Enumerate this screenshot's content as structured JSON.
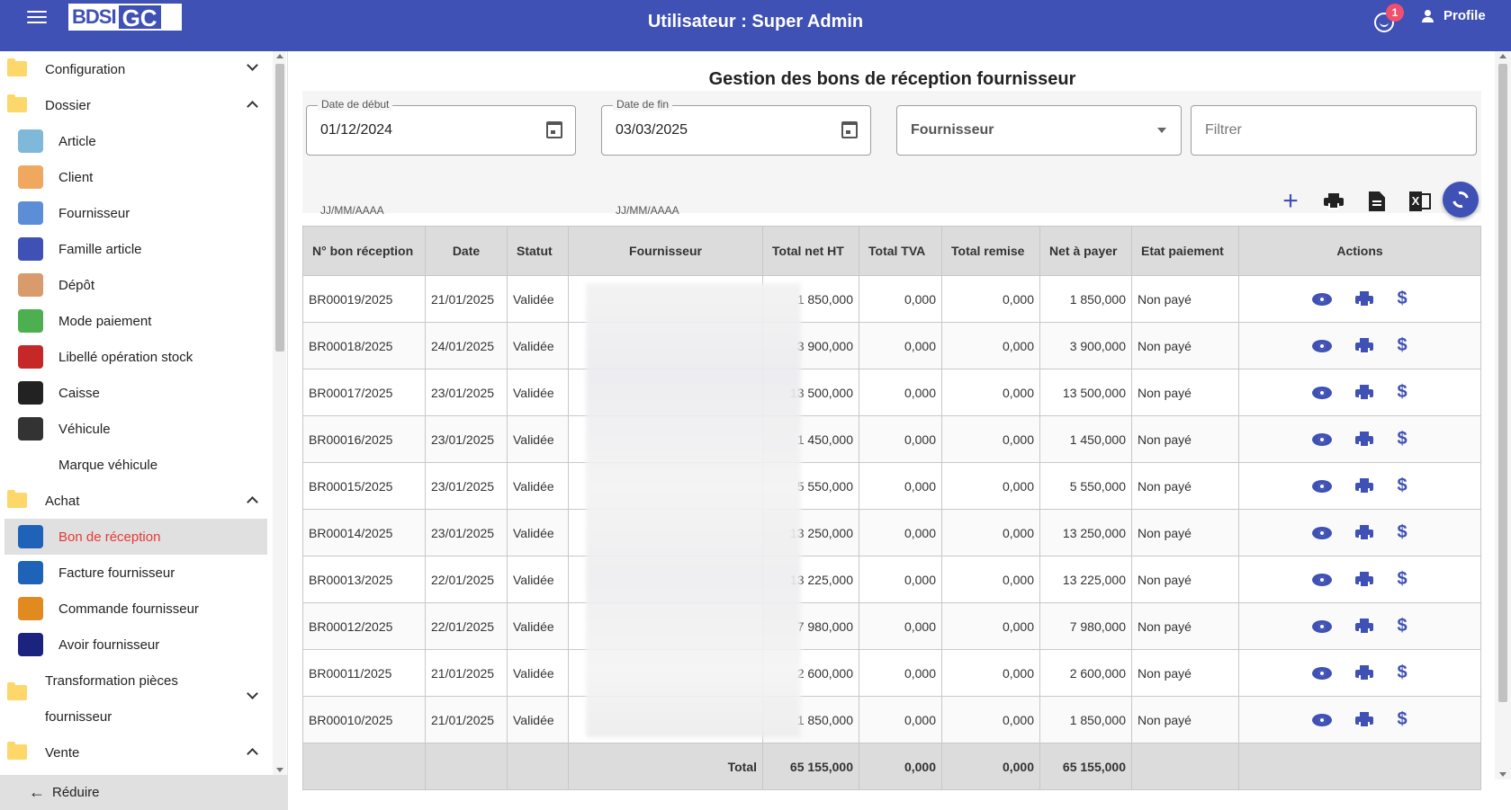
{
  "header": {
    "logo_left": "BDSI",
    "logo_right": "GC",
    "title": "Utilisateur : Super Admin",
    "notification_count": "1",
    "profile_label": "Profile",
    "brand_color": "#3f51b5"
  },
  "sidebar": {
    "items": [
      {
        "label": "Configuration",
        "type": "section",
        "expanded": false
      },
      {
        "label": "Dossier",
        "type": "section",
        "expanded": true
      },
      {
        "label": "Article",
        "type": "sub",
        "icon": "tag-icon"
      },
      {
        "label": "Client",
        "type": "sub",
        "icon": "client-icon"
      },
      {
        "label": "Fournisseur",
        "type": "sub",
        "icon": "building-icon"
      },
      {
        "label": "Famille article",
        "type": "sub",
        "icon": "group-icon"
      },
      {
        "label": "Dépôt",
        "type": "sub",
        "icon": "warehouse-icon"
      },
      {
        "label": "Mode paiement",
        "type": "sub",
        "icon": "payment-icon"
      },
      {
        "label": "Libellé opération stock",
        "type": "sub",
        "icon": "transfer-arrows-icon"
      },
      {
        "label": "Caisse",
        "type": "sub",
        "icon": "safe-icon"
      },
      {
        "label": "Véhicule",
        "type": "sub",
        "icon": "truck-icon"
      },
      {
        "label": "Marque véhicule",
        "type": "sub",
        "icon": ""
      },
      {
        "label": "Achat",
        "type": "section",
        "expanded": true
      },
      {
        "label": "Bon de réception",
        "type": "sub",
        "icon": "receipt-icon",
        "active": true
      },
      {
        "label": "Facture fournisseur",
        "type": "sub",
        "icon": "invoice-icon"
      },
      {
        "label": "Commande fournisseur",
        "type": "sub",
        "icon": "order-icon"
      },
      {
        "label": "Avoir fournisseur",
        "type": "sub",
        "icon": "reply-arrow-icon"
      },
      {
        "label": "Transformation pièces",
        "type": "section2"
      },
      {
        "label": "fournisseur",
        "type": "section2b"
      },
      {
        "label": "Vente",
        "type": "section",
        "expanded": true
      }
    ],
    "reduce_label": "Réduire"
  },
  "page": {
    "title": "Gestion des bons de réception fournisseur",
    "filters": {
      "start_label": "Date de début",
      "start_value": "01/12/2024",
      "start_hint": "JJ/MM/AAAA",
      "end_label": "Date de fin",
      "end_value": "03/03/2025",
      "end_hint": "JJ/MM/AAAA",
      "supplier_placeholder": "Fournisseur",
      "filter_placeholder": "Filtrer"
    }
  },
  "table": {
    "columns": [
      "N° bon réception",
      "Date",
      "Statut",
      "Fournisseur",
      "Total net HT",
      "Total TVA",
      "Total remise",
      "Net à payer",
      "Etat paiement",
      "Actions"
    ],
    "rows": [
      [
        "BR00019/2025",
        "21/01/2025",
        "Validée",
        "",
        "1 850,000",
        "0,000",
        "0,000",
        "1 850,000",
        "Non payé"
      ],
      [
        "BR00018/2025",
        "24/01/2025",
        "Validée",
        "",
        "3 900,000",
        "0,000",
        "0,000",
        "3 900,000",
        "Non payé"
      ],
      [
        "BR00017/2025",
        "23/01/2025",
        "Validée",
        "",
        "13 500,000",
        "0,000",
        "0,000",
        "13 500,000",
        "Non payé"
      ],
      [
        "BR00016/2025",
        "23/01/2025",
        "Validée",
        "",
        "1 450,000",
        "0,000",
        "0,000",
        "1 450,000",
        "Non payé"
      ],
      [
        "BR00015/2025",
        "23/01/2025",
        "Validée",
        "",
        "5 550,000",
        "0,000",
        "0,000",
        "5 550,000",
        "Non payé"
      ],
      [
        "BR00014/2025",
        "23/01/2025",
        "Validée",
        "",
        "13 250,000",
        "0,000",
        "0,000",
        "13 250,000",
        "Non payé"
      ],
      [
        "BR00013/2025",
        "22/01/2025",
        "Validée",
        "",
        "13 225,000",
        "0,000",
        "0,000",
        "13 225,000",
        "Non payé"
      ],
      [
        "BR00012/2025",
        "22/01/2025",
        "Validée",
        "",
        "7 980,000",
        "0,000",
        "0,000",
        "7 980,000",
        "Non payé"
      ],
      [
        "BR00011/2025",
        "21/01/2025",
        "Validée",
        "",
        "2 600,000",
        "0,000",
        "0,000",
        "2 600,000",
        "Non payé"
      ],
      [
        "BR00010/2025",
        "21/01/2025",
        "Validée",
        "",
        "1 850,000",
        "0,000",
        "0,000",
        "1 850,000",
        "Non payé"
      ]
    ],
    "footer": {
      "label": "Total",
      "total_ht": "65 155,000",
      "total_tva": "0,000",
      "total_remise": "0,000",
      "net_payer": "65 155,000"
    }
  }
}
